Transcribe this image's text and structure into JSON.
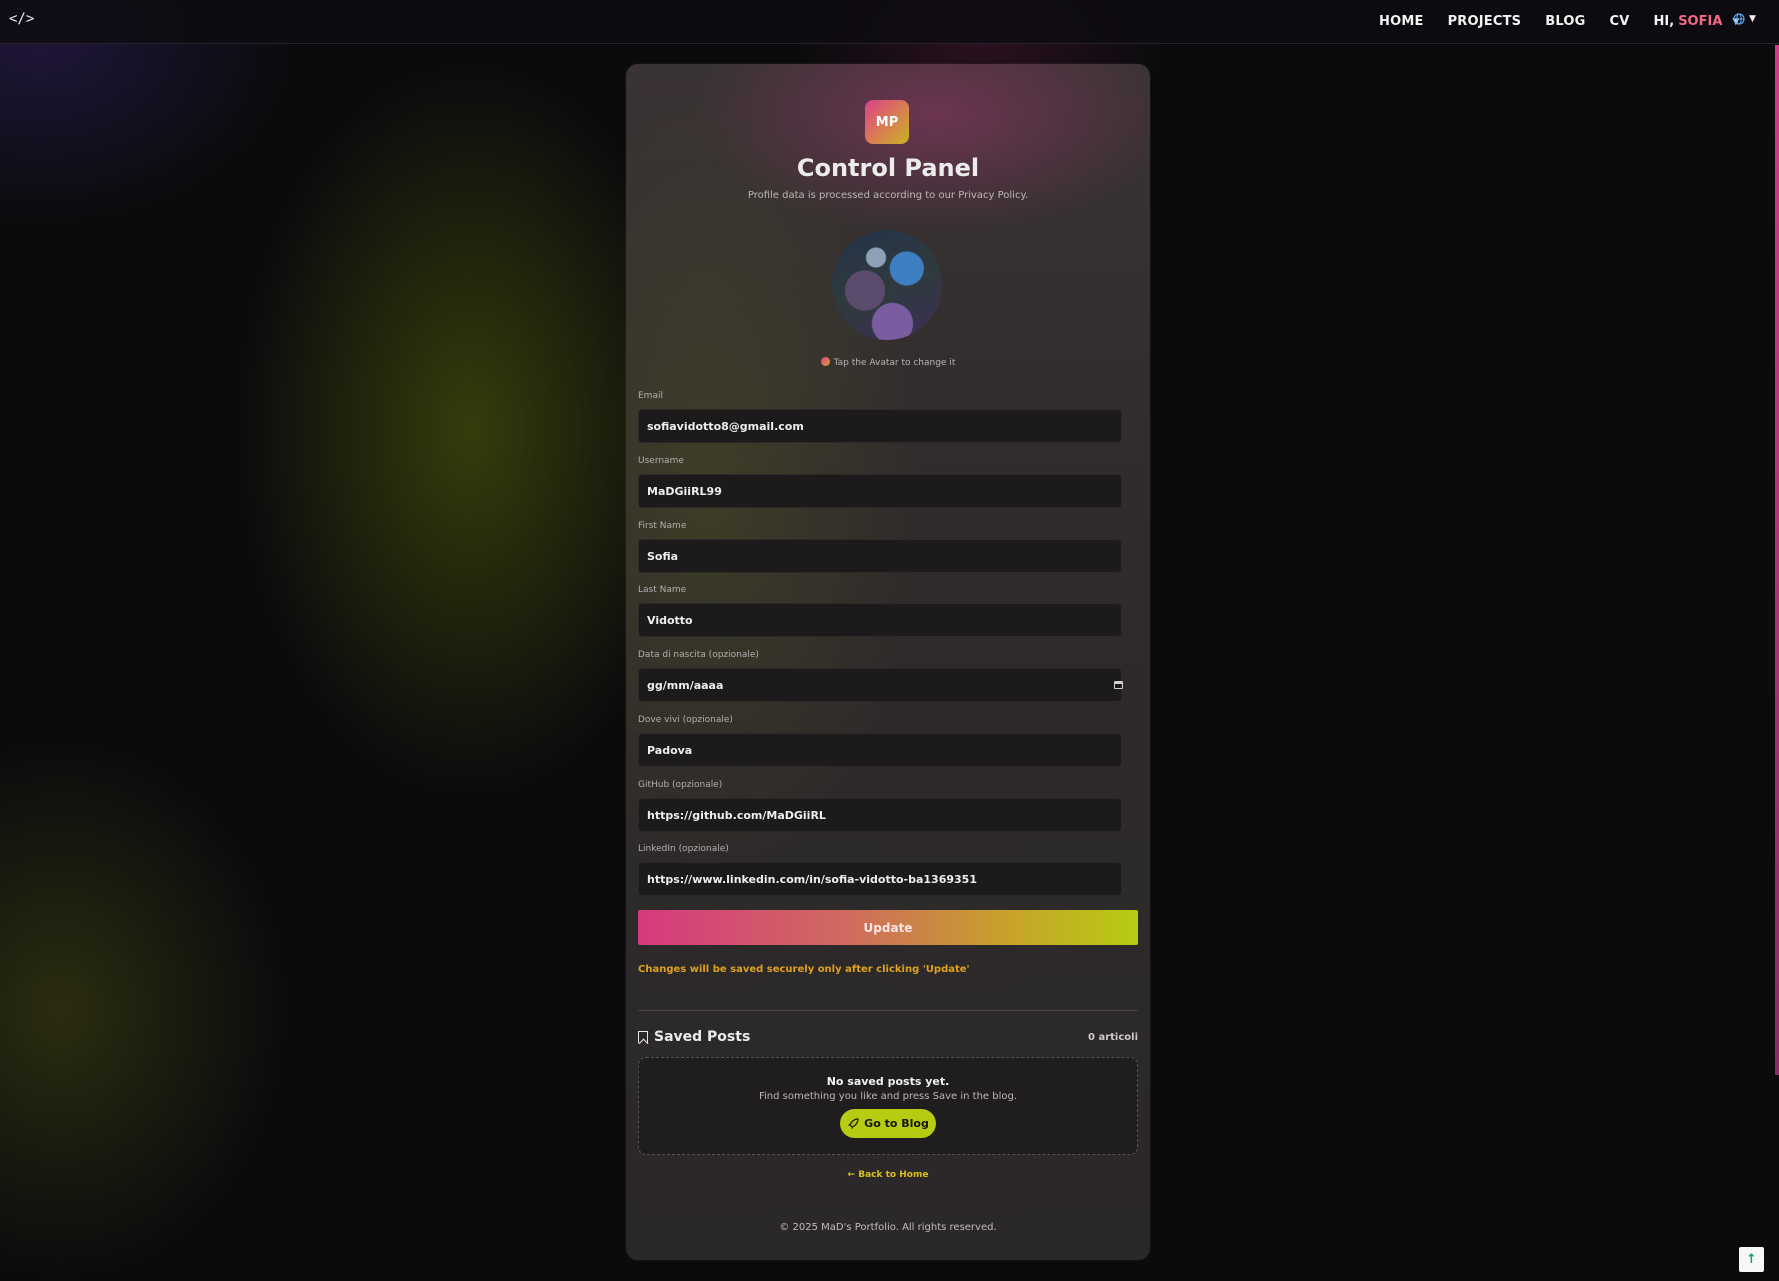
{
  "nav": {
    "logo": "</>",
    "links": [
      "HOME",
      "PROJECTS",
      "BLOG",
      "CV"
    ],
    "greeting": "HI,",
    "user_name": "SOFIA",
    "user_name_color": "#f06a86",
    "language_icon": "globe-icon"
  },
  "card": {
    "badge": "MP",
    "title": "Control Panel",
    "subtitle": "Profile data is processed according to our Privacy Policy.",
    "avatar_hint": "Tap the Avatar to change it"
  },
  "form": {
    "email": {
      "label": "Email",
      "value": "sofiavidotto8@gmail.com"
    },
    "username": {
      "label": "Username",
      "value": "MaDGiiRL99"
    },
    "first_name": {
      "label": "First Name",
      "value": "Sofia"
    },
    "last_name": {
      "label": "Last Name",
      "value": "Vidotto"
    },
    "birth_date": {
      "label": "Data di nascita (opzionale)",
      "value": "gg/mm/aaaa"
    },
    "location": {
      "label": "Dove vivi (opzionale)",
      "value": "Padova"
    },
    "github": {
      "label": "GitHub (opzionale)",
      "value": "https://github.com/MaDGiiRL"
    },
    "linkedin": {
      "label": "LinkedIn (opzionale)",
      "value": "https://www.linkedin.com/in/sofia-vidotto-ba1369351"
    },
    "update_label": "Update",
    "save_note": "Changes will be saved securely only after clicking 'Update'"
  },
  "saved_posts": {
    "title": "Saved Posts",
    "count": "0 articoli",
    "empty_title": "No saved posts yet.",
    "empty_sub": "Find something you like and press Save in the blog.",
    "go_blog": "Go to Blog"
  },
  "back_home": "← Back to Home",
  "footer": "© 2025 MaD's Portfolio. All rights reserved.",
  "colors": {
    "accent_pink": "#d6397f",
    "accent_lime": "#b6cc12",
    "note_yellow": "#e0a21e"
  }
}
